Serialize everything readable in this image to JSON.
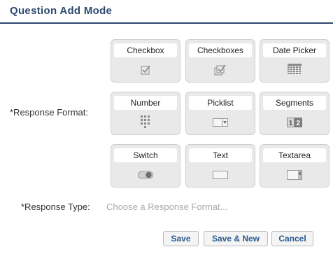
{
  "header": {
    "title": "Question Add Mode"
  },
  "form": {
    "response_format_label": "*Response Format:",
    "response_type_label": "*Response Type:",
    "response_type_value": "Choose a Response Format..."
  },
  "formats": [
    {
      "label": "Checkbox",
      "icon": "checkbox-icon"
    },
    {
      "label": "Checkboxes",
      "icon": "checkboxes-icon"
    },
    {
      "label": "Date Picker",
      "icon": "calendar-grid-icon"
    },
    {
      "label": "Number",
      "icon": "keypad-icon"
    },
    {
      "label": "Picklist",
      "icon": "dropdown-icon"
    },
    {
      "label": "Segments",
      "icon": "segments-icon",
      "icon_text": [
        "1",
        "2"
      ]
    },
    {
      "label": "Switch",
      "icon": "toggle-icon"
    },
    {
      "label": "Text",
      "icon": "text-field-icon"
    },
    {
      "label": "Textarea",
      "icon": "textarea-icon"
    }
  ],
  "buttons": {
    "save": "Save",
    "save_new": "Save & New",
    "cancel": "Cancel"
  },
  "colors": {
    "header_title": "#2c4a6e",
    "button_text": "#2a5a8e",
    "tile_bg": "#e9e9e9",
    "placeholder": "#aaaaaa"
  }
}
